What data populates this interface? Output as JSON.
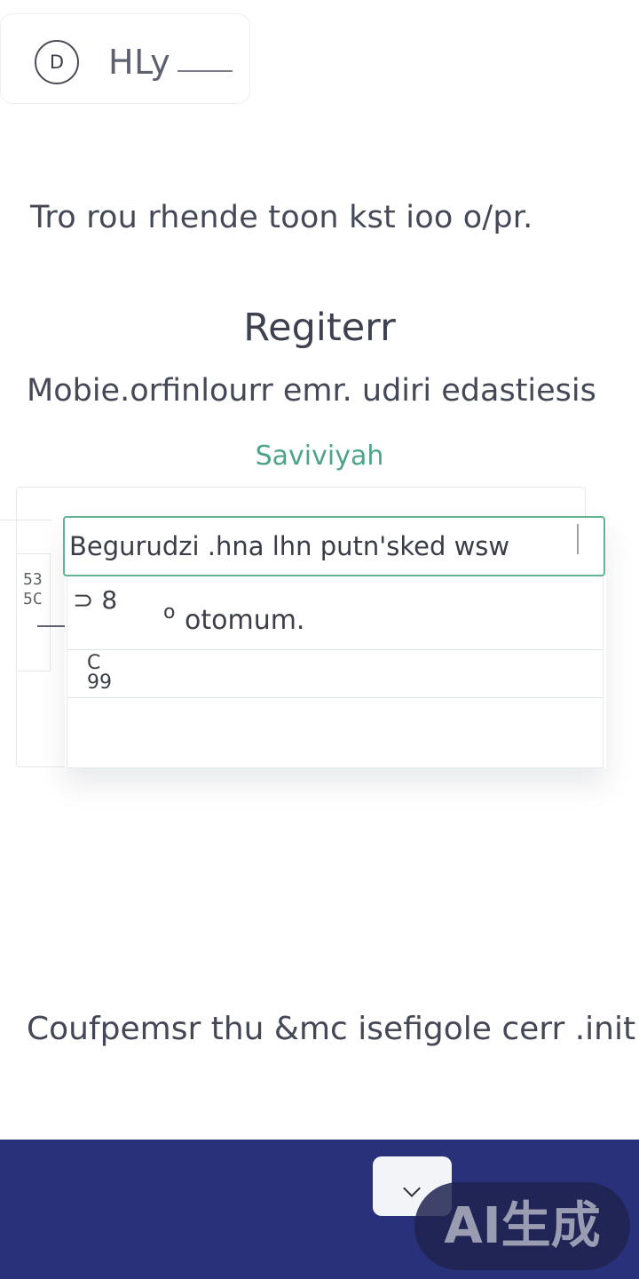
{
  "header": {
    "logo_letter": "D",
    "title": "HLy"
  },
  "intro": {
    "text": "Tro rou rhende toon kst ioo o/pr."
  },
  "register": {
    "title": "Regiterr",
    "subtitle": "Mobie.orfinlourr emr. udiri edastiesis",
    "status": "Saviviyah"
  },
  "form": {
    "search_value": "Begurudzi .hna lhn putn'sked wsw",
    "side_marks": "53\n5C",
    "options": [
      {
        "icon": "⊃ 8",
        "icon_b": "o",
        "label": "otomum."
      },
      {
        "label": "C\n99"
      },
      {
        "label": ""
      }
    ]
  },
  "footer": {
    "text": "Coufpemsr thu &mc  isefigole cerr .init"
  },
  "bottom_bar": {
    "color": "#28317a",
    "button_icon": "chevron-down-icon"
  },
  "watermark": {
    "text": "AI生成"
  },
  "colors": {
    "accent": "#61b48f",
    "status": "#4ea585",
    "navy": "#28317a"
  }
}
